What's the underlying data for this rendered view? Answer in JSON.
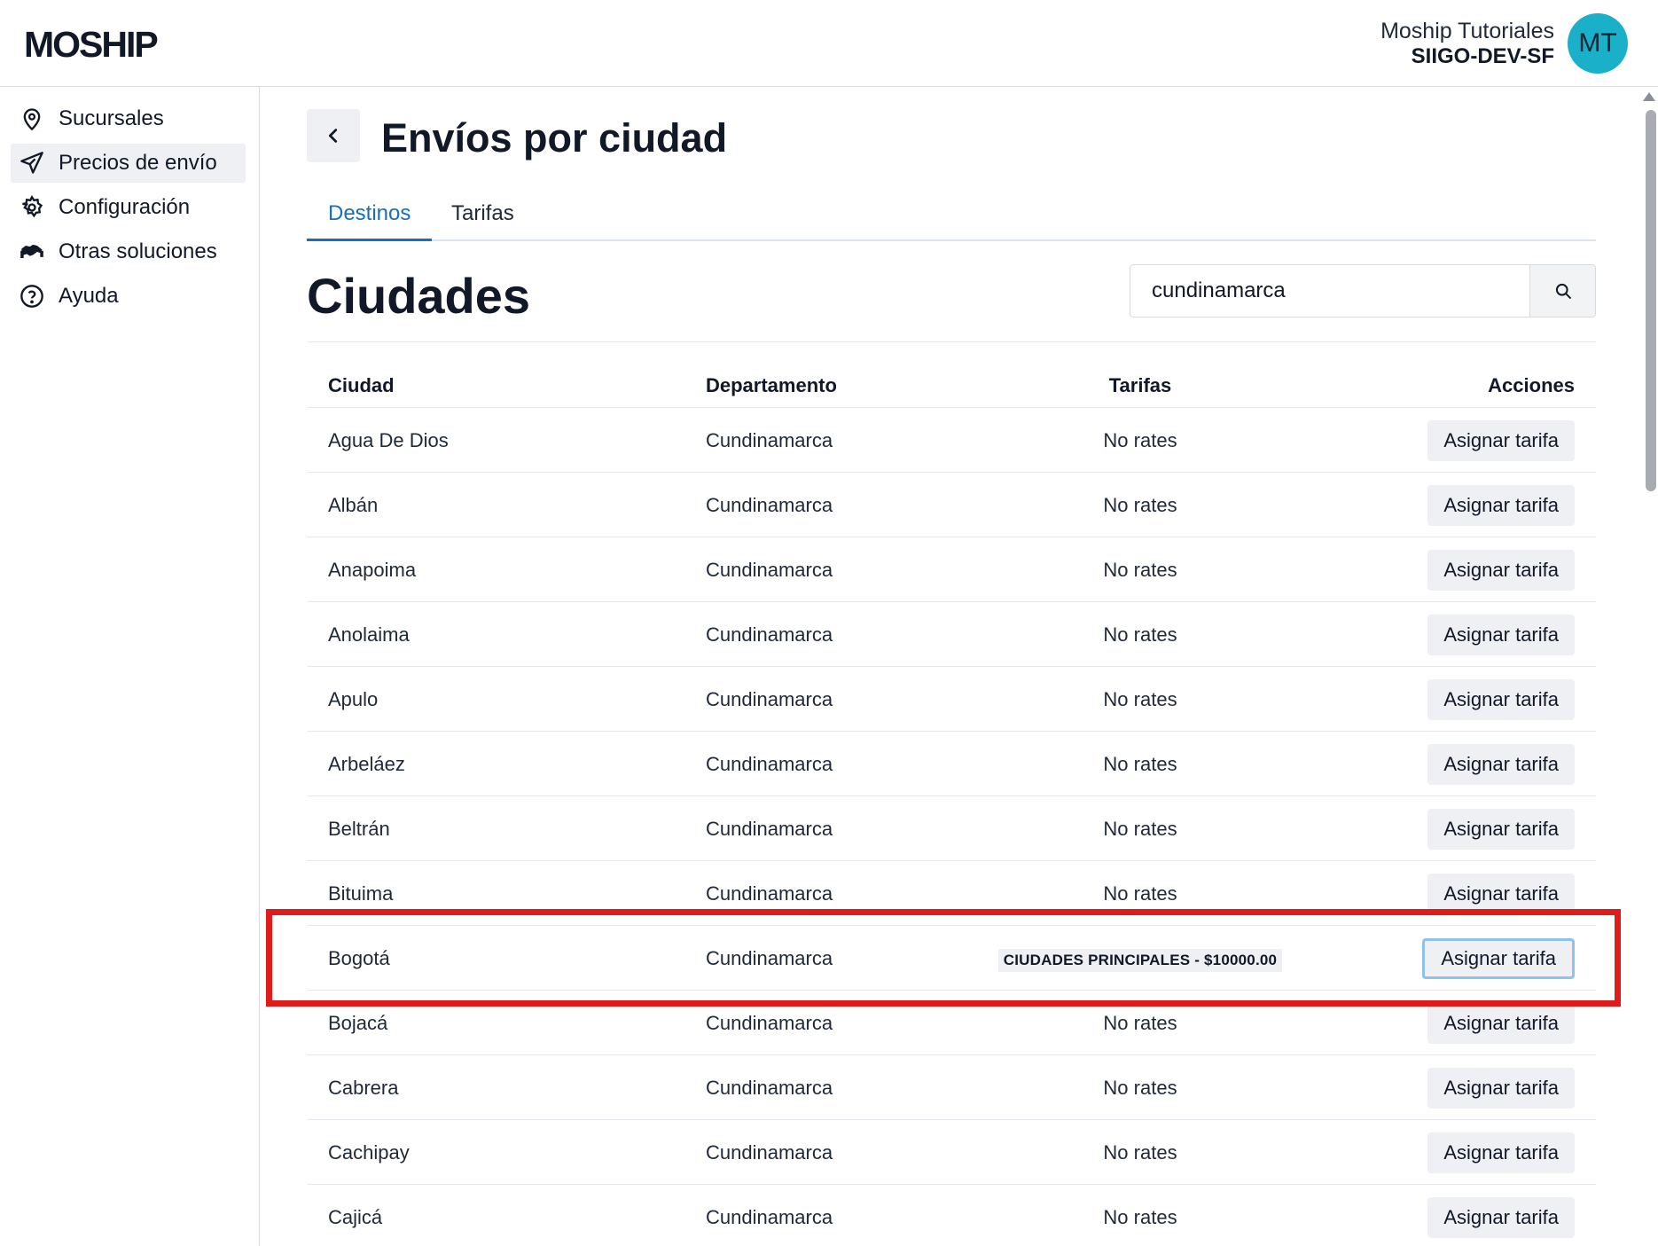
{
  "header": {
    "logo_text": "MOSHIP",
    "user_name": "Moship Tutoriales",
    "org_name": "SIIGO-DEV-SF",
    "avatar_initials": "MT",
    "avatar_color": "#1ab0c9"
  },
  "sidebar": {
    "items": [
      {
        "label": "Sucursales",
        "icon": "location-pin-icon",
        "active": false
      },
      {
        "label": "Precios de envío",
        "icon": "paper-plane-icon",
        "active": true
      },
      {
        "label": "Configuración",
        "icon": "gear-icon",
        "active": false
      },
      {
        "label": "Otras soluciones",
        "icon": "handshake-icon",
        "active": false
      },
      {
        "label": "Ayuda",
        "icon": "question-circle-icon",
        "active": false
      }
    ]
  },
  "main": {
    "page_title": "Envíos por ciudad",
    "tabs": [
      {
        "label": "Destinos",
        "active": true
      },
      {
        "label": "Tarifas",
        "active": false
      }
    ],
    "section_title": "Ciudades",
    "search": {
      "value": "cundinamarca",
      "placeholder": ""
    },
    "table": {
      "headers": {
        "city": "Ciudad",
        "department": "Departamento",
        "rates": "Tarifas",
        "actions": "Acciones"
      },
      "rows": [
        {
          "city": "Agua De Dios",
          "department": "Cundinamarca",
          "rates": "No rates",
          "action": "Asignar tarifa"
        },
        {
          "city": "Albán",
          "department": "Cundinamarca",
          "rates": "No rates",
          "action": "Asignar tarifa"
        },
        {
          "city": "Anapoima",
          "department": "Cundinamarca",
          "rates": "No rates",
          "action": "Asignar tarifa"
        },
        {
          "city": "Anolaima",
          "department": "Cundinamarca",
          "rates": "No rates",
          "action": "Asignar tarifa"
        },
        {
          "city": "Apulo",
          "department": "Cundinamarca",
          "rates": "No rates",
          "action": "Asignar tarifa"
        },
        {
          "city": "Arbeláez",
          "department": "Cundinamarca",
          "rates": "No rates",
          "action": "Asignar tarifa"
        },
        {
          "city": "Beltrán",
          "department": "Cundinamarca",
          "rates": "No rates",
          "action": "Asignar tarifa"
        },
        {
          "city": "Bituima",
          "department": "Cundinamarca",
          "rates": "No rates",
          "action": "Asignar tarifa"
        },
        {
          "city": "Bogotá",
          "department": "Cundinamarca",
          "rates": "CIUDADES PRINCIPALES - $10000.00",
          "action": "Asignar tarifa"
        },
        {
          "city": "Bojacá",
          "department": "Cundinamarca",
          "rates": "No rates",
          "action": "Asignar tarifa"
        },
        {
          "city": "Cabrera",
          "department": "Cundinamarca",
          "rates": "No rates",
          "action": "Asignar tarifa"
        },
        {
          "city": "Cachipay",
          "department": "Cundinamarca",
          "rates": "No rates",
          "action": "Asignar tarifa"
        },
        {
          "city": "Cajicá",
          "department": "Cundinamarca",
          "rates": "No rates",
          "action": "Asignar tarifa"
        }
      ]
    }
  },
  "colors": {
    "accent": "#1a6fb5",
    "highlight_box": "#e01b1b",
    "button_bg": "#eef0f3",
    "focus_ring": "#8ec2e8"
  }
}
